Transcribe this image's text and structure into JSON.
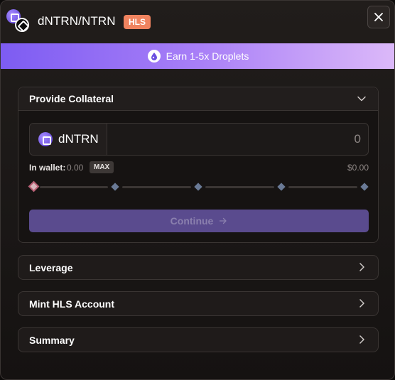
{
  "header": {
    "title": "dNTRN/NTRN",
    "badge": "HLS",
    "close_icon": "close-icon",
    "pair_icon": "token-pair-icon"
  },
  "banner": {
    "text": "Earn 1-5x Droplets",
    "icon": "droplet-icon"
  },
  "collateral": {
    "title": "Provide Collateral",
    "asset": "dNTRN",
    "amount_placeholder": "0",
    "wallet_label": "In wallet:",
    "wallet_value": "0.00",
    "max_label": "MAX",
    "usd_value": "$0.00",
    "slider_value_percent": 0,
    "continue_label": "Continue"
  },
  "sections": [
    {
      "label": "Leverage"
    },
    {
      "label": "Mint HLS Account"
    },
    {
      "label": "Summary"
    }
  ],
  "colors": {
    "accent": "#7d5cf2",
    "badge": "#f0835f",
    "continue_bg": "#5a4b8e"
  }
}
